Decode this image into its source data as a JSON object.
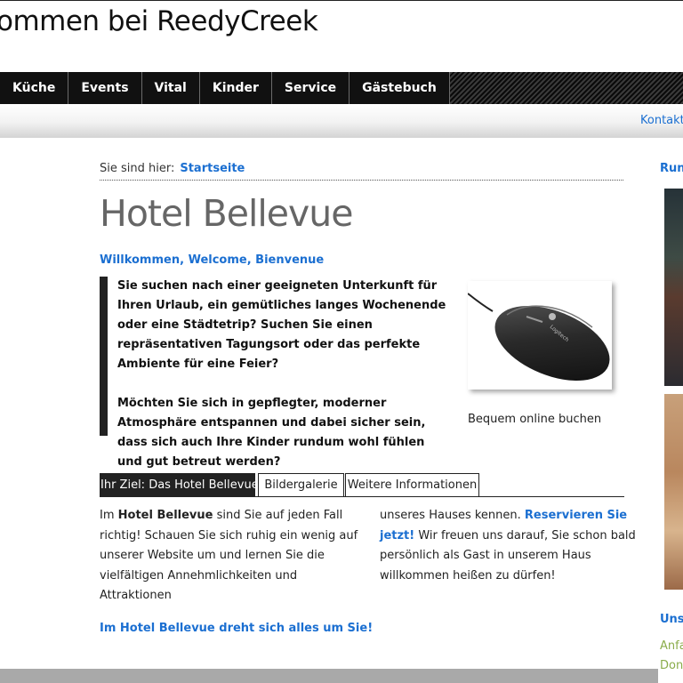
{
  "header": {
    "site_title": "ommen bei ReedyCreek"
  },
  "nav": {
    "items": [
      "Küche",
      "Events",
      "Vital",
      "Kinder",
      "Service",
      "Gästebuch"
    ]
  },
  "subbar": {
    "contact_label": "Kontakt"
  },
  "breadcrumb": {
    "label": "Sie sind hier:",
    "link": "Startseite"
  },
  "main": {
    "title": "Hotel Bellevue",
    "welcome": "Willkommen, Welcome, Bienvenue",
    "intro_p1": "Sie suchen nach einer geeigneten Unterkunft für Ihren Urlaub, ein gemütliches langes Wochenende oder eine Städtetrip? Suchen Sie einen repräsentativen Tagungsort oder das perfekte Ambiente für eine Feier?",
    "intro_p2": "Möchten Sie sich in gepflegter, moderner Atmosphäre entspannen und dabei sicher sein, dass sich auch Ihre Kinder rundum wohl fühlen und gut betreut werden?",
    "photo_caption": "Bequem online buchen",
    "photo_logo_text": "Logitech",
    "tabs": [
      {
        "label": "Ihr Ziel: Das Hotel Bellevue",
        "active": true
      },
      {
        "label": "Bildergalerie",
        "active": false
      },
      {
        "label": "Weitere Informationen",
        "active": false
      }
    ],
    "body_prefix": "Im ",
    "body_hotel": "Hotel Bellevue",
    "body_left_rest": " sind Sie auf jeden Fall richtig! Schauen Sie sich ruhig ein wenig auf unserer Website um und lernen Sie die vielfältigen Annehmlichkeiten und Attraktionen",
    "body_right_start": "unseres Hauses kennen. ",
    "body_reserve_link": "Reservieren Sie jetzt!",
    "body_right_rest": " Wir freuen uns darauf, Sie schon bald persönlich als Gast in unserem Haus willkommen heißen zu dürfen!",
    "tagline": "Im Hotel Bellevue dreht sich alles um Sie!"
  },
  "sidebar": {
    "heading_1": "Run",
    "heading_2": "Uns",
    "link_1": "Anfa",
    "link_2": "Don"
  },
  "colors": {
    "accent": "#1b6fd1",
    "nav_bg": "#111111",
    "sidebar_link": "#8aac4a"
  }
}
